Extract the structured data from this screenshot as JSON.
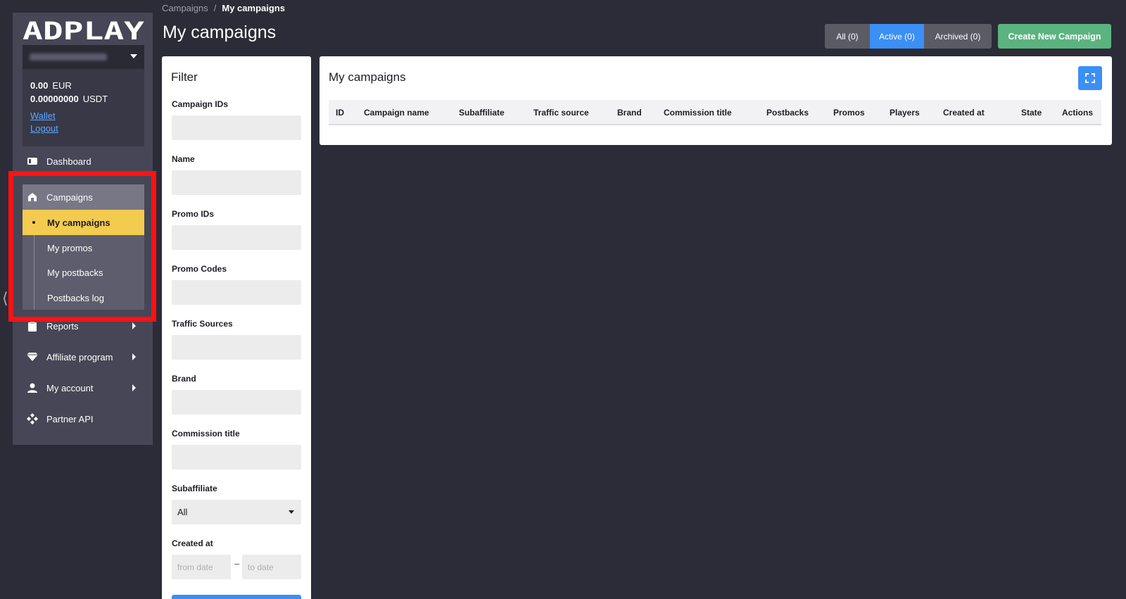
{
  "sidebar": {
    "logo_text": "ADPLAY",
    "balance": [
      {
        "amount": "0.00",
        "currency": "EUR"
      },
      {
        "amount": "0.00000000",
        "currency": "USDT"
      }
    ],
    "wallet_link": "Wallet",
    "logout_link": "Logout",
    "nav": {
      "dashboard": "Dashboard",
      "campaigns": "Campaigns",
      "campaigns_sub": [
        "My campaigns",
        "My promos",
        "My postbacks",
        "Postbacks log"
      ],
      "reports": "Reports",
      "affiliate_program": "Affiliate program",
      "my_account": "My account",
      "partner_api": "Partner API"
    }
  },
  "header": {
    "breadcrumb": [
      "Campaigns",
      "My campaigns"
    ],
    "breadcrumb_sep": "/",
    "title": "My campaigns",
    "filters": {
      "all": "All (0)",
      "active": "Active (0)",
      "archived": "Archived (0)"
    },
    "create_button": "Create New Campaign"
  },
  "filter": {
    "title": "Filter",
    "fields": {
      "campaign_ids": "Campaign IDs",
      "name": "Name",
      "promo_ids": "Promo IDs",
      "promo_codes": "Promo Codes",
      "traffic_sources": "Traffic Sources",
      "brand": "Brand",
      "commission_title": "Commission title",
      "subaffiliate": "Subaffiliate",
      "created_at": "Created at"
    },
    "subaffiliate_value": "All",
    "from_date_placeholder": "from date",
    "to_date_placeholder": "to date",
    "date_sep": "–"
  },
  "campaigns_table": {
    "title": "My campaigns",
    "columns": [
      "ID",
      "Campaign name",
      "Subaffiliate",
      "Traffic source",
      "Brand",
      "Commission title",
      "Postbacks",
      "Promos",
      "Players",
      "Created at",
      "State",
      "Actions"
    ]
  },
  "colors": {
    "background": "#2c2c38",
    "sidebar": "#464656",
    "active_yellow": "#f3cb4f",
    "primary_blue": "#3b8ff5",
    "create_green": "#5bb37f",
    "highlight_red": "#ff1212"
  }
}
